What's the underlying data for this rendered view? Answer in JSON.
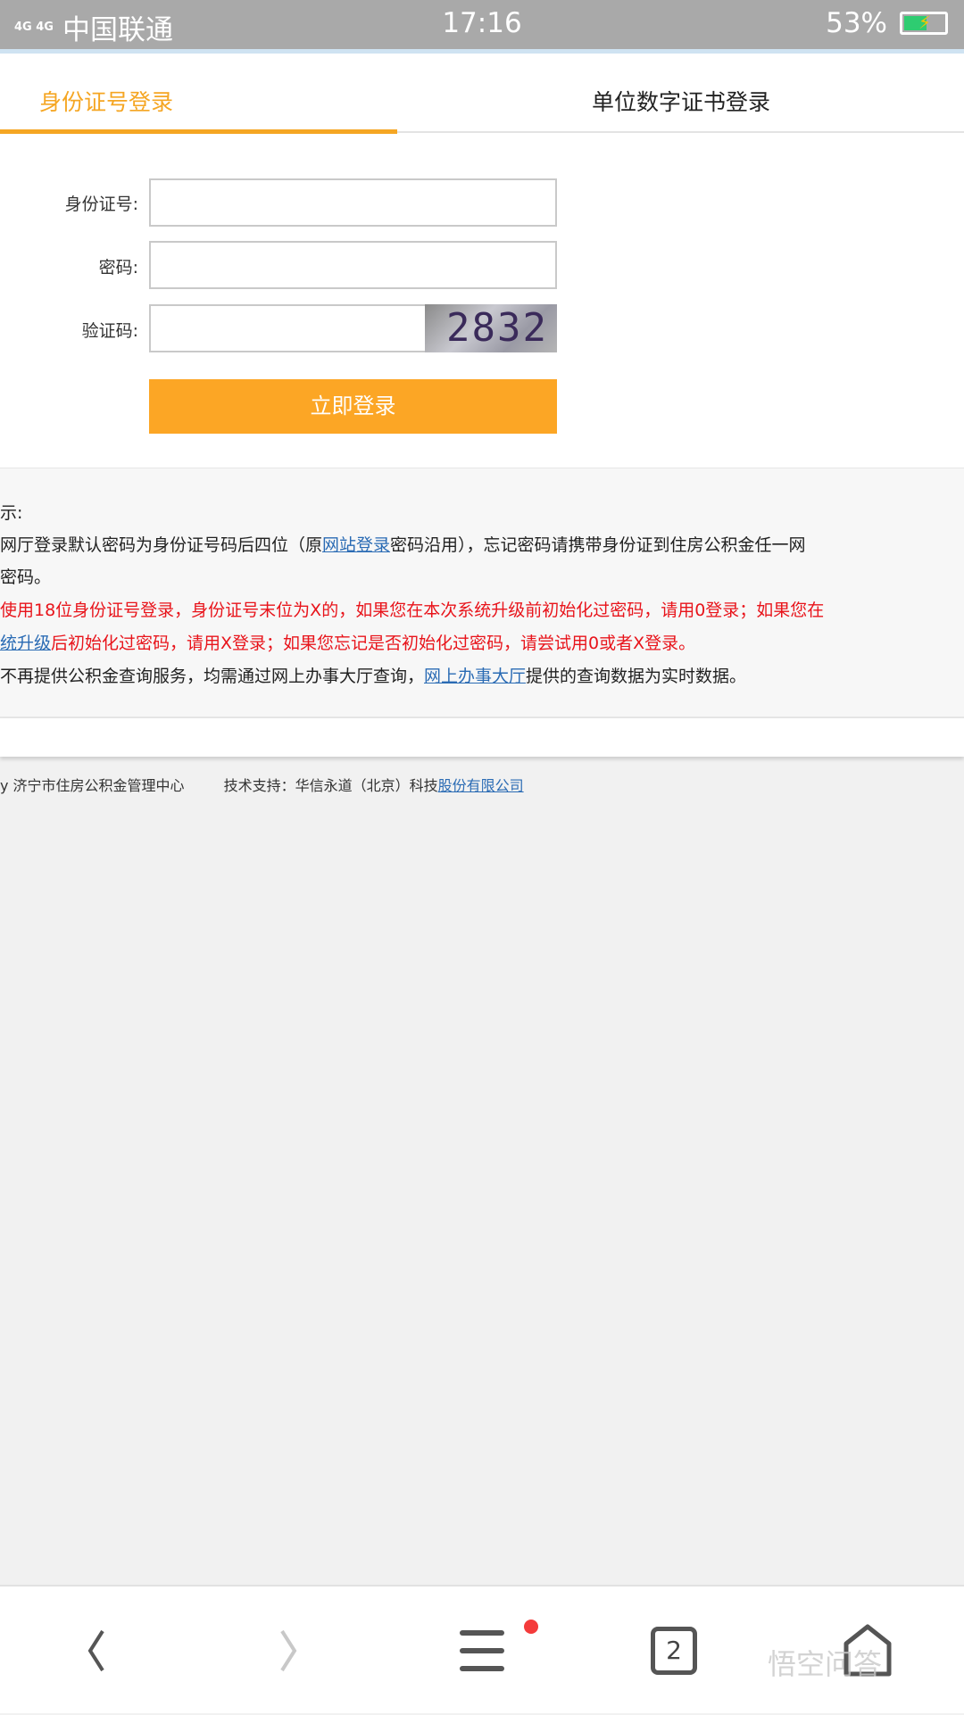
{
  "status_bar": {
    "network": "4G 4G",
    "carrier": "中国联通",
    "time": "17:16",
    "battery": "53%",
    "battery_level": 0.53
  },
  "tabs": [
    {
      "label": "身份证号登录",
      "active": true
    },
    {
      "label": "单位数字证书登录",
      "active": false
    }
  ],
  "form": {
    "id_label": "身份证号:",
    "id_value": "",
    "password_label": "密码:",
    "password_value": "",
    "captcha_label": "验证码:",
    "captcha_value": "",
    "captcha_image_text": "2832",
    "submit_label": "立即登录"
  },
  "tips": {
    "heading": "示:",
    "line1a": "网厅登录默认密码为身份证号码后四位（原",
    "line1_link": "网站登录",
    "line1b": "密码沿用），忘记密码请携带身份证到住房公积金任一网",
    "line2": "密码。",
    "line3": "使用18位身份证号登录，身份证号末位为X的，如果您在本次系统升级前初始化过密码，请用0登录；如果您在",
    "line4_link": "统升级",
    "line4": "后初始化过密码，请用X登录；如果您忘记是否初始化过密码，请尝试用0或者X登录。",
    "line5a": "不再提供公积金查询服务，均需通过网上办事大厅查询，",
    "line5_link": "网上办事大厅",
    "line5b": "提供的查询数据为实时数据。"
  },
  "footer": {
    "owner": "y 济宁市住房公积金管理中心",
    "support": "技术支持：华信永道（北京）科技",
    "support_link": "股份有限公司"
  },
  "bottom_nav": {
    "tab_count": "2",
    "watermark": "悟空问答",
    "accent": "#f5a623"
  }
}
